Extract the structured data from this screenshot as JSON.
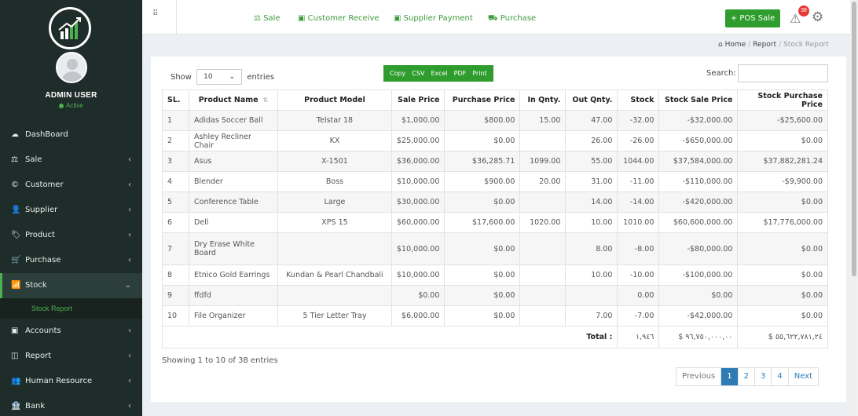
{
  "sidebar": {
    "user_name": "ADMIN USER",
    "user_status": "Active",
    "items": [
      {
        "icon": "☁",
        "label": "DashBoard",
        "arrow": ""
      },
      {
        "icon": "⚖",
        "label": "Sale",
        "arrow": "‹"
      },
      {
        "icon": "©",
        "label": "Customer",
        "arrow": "‹"
      },
      {
        "icon": "👤",
        "label": "Supplier",
        "arrow": "‹"
      },
      {
        "icon": "🏷",
        "label": "Product",
        "arrow": "‹"
      },
      {
        "icon": "🛒",
        "label": "Purchase",
        "arrow": "‹"
      },
      {
        "icon": "📶",
        "label": "Stock",
        "arrow": "⌄"
      }
    ],
    "sub_item": "Stock Report",
    "items_after": [
      {
        "icon": "▣",
        "label": "Accounts",
        "arrow": "‹"
      },
      {
        "icon": "◫",
        "label": "Report",
        "arrow": "‹"
      },
      {
        "icon": "👥",
        "label": "Human Resource",
        "arrow": "‹"
      },
      {
        "icon": "🏦",
        "label": "Bank",
        "arrow": "‹"
      }
    ]
  },
  "topbar": {
    "links": [
      "Sale",
      "Customer Receive",
      "Supplier Payment",
      "Purchase"
    ],
    "pos_button": "+ POS Sale",
    "notification_count": "38"
  },
  "breadcrumb": {
    "home": "Home",
    "report": "Report",
    "current": "Stock Report"
  },
  "table_controls": {
    "show_label": "Show",
    "entries_value": "10",
    "entries_label": "entries",
    "export_buttons": [
      "Copy",
      "CSV",
      "Excel",
      "PDF",
      "Print"
    ],
    "search_label": "Search:"
  },
  "table": {
    "headers": [
      "SL.",
      "Product Name",
      "Product Model",
      "Sale Price",
      "Purchase Price",
      "In Qnty.",
      "Out Qnty.",
      "Stock",
      "Stock Sale Price",
      "Stock Purchase Price"
    ],
    "rows": [
      [
        "1",
        "Adidas Soccer Ball",
        "Telstar 18",
        "$1,000.00",
        "$800.00",
        "15.00",
        "47.00",
        "-32.00",
        "-$32,000.00",
        "-$25,600.00"
      ],
      [
        "2",
        "Ashley Recliner Chair",
        "KX",
        "$25,000.00",
        "$0.00",
        "",
        "26.00",
        "-26.00",
        "-$650,000.00",
        "$0.00"
      ],
      [
        "3",
        "Asus",
        "X-1501",
        "$36,000.00",
        "$36,285.71",
        "1099.00",
        "55.00",
        "1044.00",
        "$37,584,000.00",
        "$37,882,281.24"
      ],
      [
        "4",
        "Blender",
        "Boss",
        "$10,000.00",
        "$900.00",
        "20.00",
        "31.00",
        "-11.00",
        "-$110,000.00",
        "-$9,900.00"
      ],
      [
        "5",
        "Conference Table",
        "Large",
        "$30,000.00",
        "$0.00",
        "",
        "14.00",
        "-14.00",
        "-$420,000.00",
        "$0.00"
      ],
      [
        "6",
        "Dell",
        "XPS 15",
        "$60,000.00",
        "$17,600.00",
        "1020.00",
        "10.00",
        "1010.00",
        "$60,600,000.00",
        "$17,776,000.00"
      ],
      [
        "7",
        "Dry Erase White Board",
        "",
        "$10,000.00",
        "$0.00",
        "",
        "8.00",
        "-8.00",
        "-$80,000.00",
        "$0.00"
      ],
      [
        "8",
        "Etnico Gold Earrings",
        "Kundan & Pearl Chandbali",
        "$10,000.00",
        "$0.00",
        "",
        "10.00",
        "-10.00",
        "-$100,000.00",
        "$0.00"
      ],
      [
        "9",
        "ffdfd",
        "",
        "$0.00",
        "$0.00",
        "",
        "",
        "0.00",
        "$0.00",
        "$0.00"
      ],
      [
        "10",
        "File Organizer",
        "5 Tier Letter Tray",
        "$6,000.00",
        "$0.00",
        "",
        "7.00",
        "-7.00",
        "-$42,000.00",
        "$0.00"
      ]
    ],
    "total_label": "Total :",
    "total_stock": "١,٩٤٦",
    "total_sale": "$ ٩٦,٧٥٠,٠٠٠,٠٠",
    "total_purchase": "$ ٥٥,٦٢٢,٧٨١,٢٤"
  },
  "footer": {
    "info": "Showing 1 to 10 of 38 entries",
    "pages": [
      "Previous",
      "1",
      "2",
      "3",
      "4",
      "Next"
    ]
  }
}
